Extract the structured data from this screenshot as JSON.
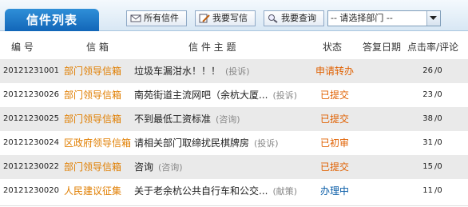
{
  "header": {
    "title": "信件列表",
    "buttons": [
      {
        "label": "所有信件",
        "icon": "envelope-icon"
      },
      {
        "label": "我要写信",
        "icon": "pencil-icon"
      },
      {
        "label": "我要查询",
        "icon": "magnifier-icon"
      }
    ],
    "department_select": {
      "value": "-- 请选择部门 --"
    }
  },
  "table": {
    "columns": [
      "编 号",
      "信 箱",
      "信 件 主 题",
      "状态",
      "答复日期",
      "点击率/评论"
    ],
    "rows": [
      {
        "no": "20121231001",
        "category": "部门领导信箱",
        "subject": "垃圾车漏泔水！！！",
        "tag": "(投诉)",
        "status": "申请转办",
        "status_color": "#e06000",
        "reply_date": "",
        "clicks": "26",
        "comments": "/0"
      },
      {
        "no": "20121230026",
        "category": "部门领导信箱",
        "subject": "南苑街道主流网吧（余杭大厦...",
        "tag": "(投诉)",
        "status": "已提交",
        "status_color": "#e06000",
        "reply_date": "",
        "clicks": "23",
        "comments": "/0"
      },
      {
        "no": "20121230025",
        "category": "部门领导信箱",
        "subject": "不到最低工资标准",
        "tag": "(咨询)",
        "status": "已提交",
        "status_color": "#e06000",
        "reply_date": "",
        "clicks": "38",
        "comments": "/0"
      },
      {
        "no": "20121230024",
        "category": "区政府领导信箱",
        "subject": "请相关部门取缔扰民棋牌房",
        "tag": "(投诉)",
        "status": "已初审",
        "status_color": "#e06000",
        "reply_date": "",
        "clicks": "31",
        "comments": "/0"
      },
      {
        "no": "20121230022",
        "category": "部门领导信箱",
        "subject": "咨询",
        "tag": "(咨询)",
        "status": "已提交",
        "status_color": "#e06000",
        "reply_date": "",
        "clicks": "15",
        "comments": "/0"
      },
      {
        "no": "20121230020",
        "category": "人民建议征集",
        "subject": "关于老余杭公共自行车和公交...",
        "tag": "(献策)",
        "status": "办理中",
        "status_color": "#0b5ea8",
        "reply_date": "",
        "clicks": "11",
        "comments": "/0"
      }
    ]
  }
}
